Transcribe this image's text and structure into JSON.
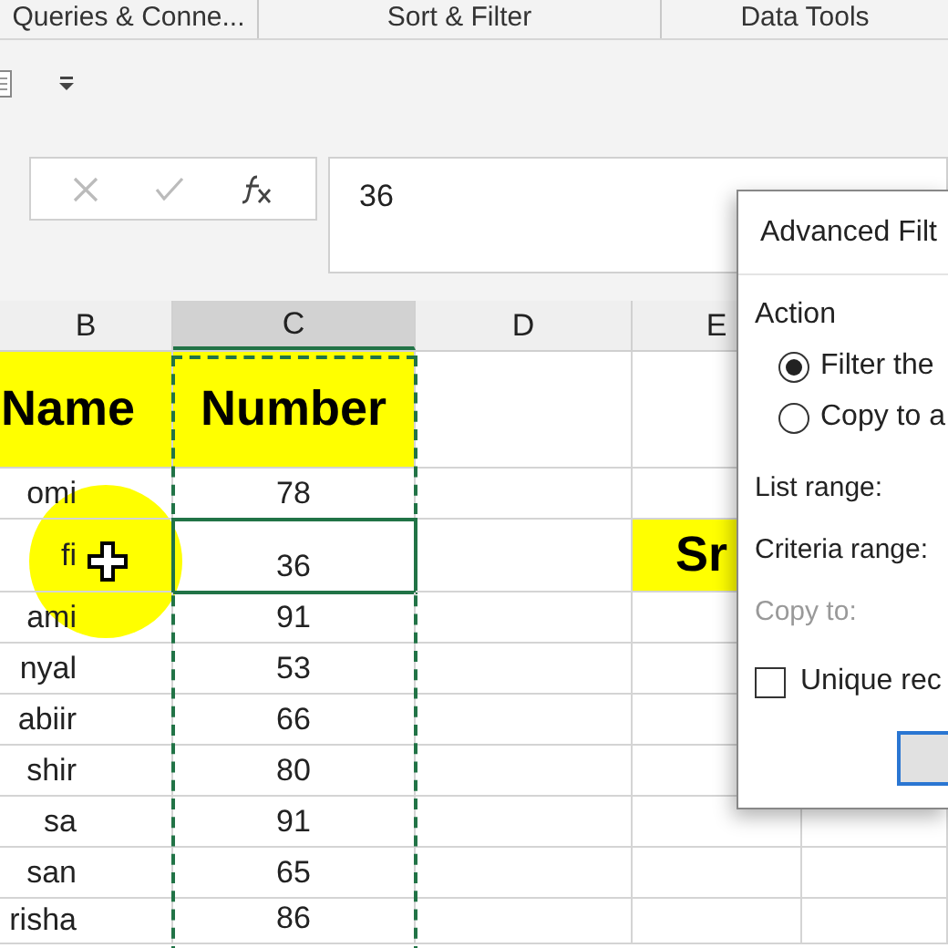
{
  "ribbon_groups": [
    {
      "label": "Queries & Conne..."
    },
    {
      "label": "Sort & Filter"
    },
    {
      "label": "Data Tools"
    }
  ],
  "formula_bar": {
    "value": "36"
  },
  "columns": [
    {
      "label": "B",
      "selected": false
    },
    {
      "label": "C",
      "selected": true
    },
    {
      "label": "D",
      "selected": false
    },
    {
      "label": "E",
      "selected": false
    }
  ],
  "rows": [
    {
      "kind": "header",
      "name": "Name",
      "number": "Number",
      "selected": false
    },
    {
      "kind": "data",
      "name": "omi",
      "number": "78",
      "selected": false
    },
    {
      "kind": "data",
      "name": "fi",
      "number": "36",
      "selected": true,
      "column_e": "Sr"
    },
    {
      "kind": "data",
      "name": "ami",
      "number": "91",
      "selected": false
    },
    {
      "kind": "data",
      "name": "nyal",
      "number": "53",
      "selected": false
    },
    {
      "kind": "data",
      "name": "abiir",
      "number": "66",
      "selected": false
    },
    {
      "kind": "data",
      "name": "shir",
      "number": "80",
      "selected": false
    },
    {
      "kind": "data",
      "name": "sa",
      "number": "91",
      "selected": false
    },
    {
      "kind": "data",
      "name": "san",
      "number": "65",
      "selected": false
    },
    {
      "kind": "data",
      "name": "risha",
      "number": "86",
      "selected": false
    }
  ],
  "dialog": {
    "title": "Advanced Filt",
    "action_label": "Action",
    "options": [
      {
        "label": "Filter the",
        "selected": true
      },
      {
        "label": "Copy to a",
        "selected": false
      }
    ],
    "fields": [
      {
        "label": "List range:",
        "disabled": false
      },
      {
        "label": "Criteria range:",
        "disabled": false
      },
      {
        "label": "Copy to:",
        "disabled": true
      }
    ],
    "unique": {
      "label": "Unique rec",
      "checked": false
    }
  }
}
